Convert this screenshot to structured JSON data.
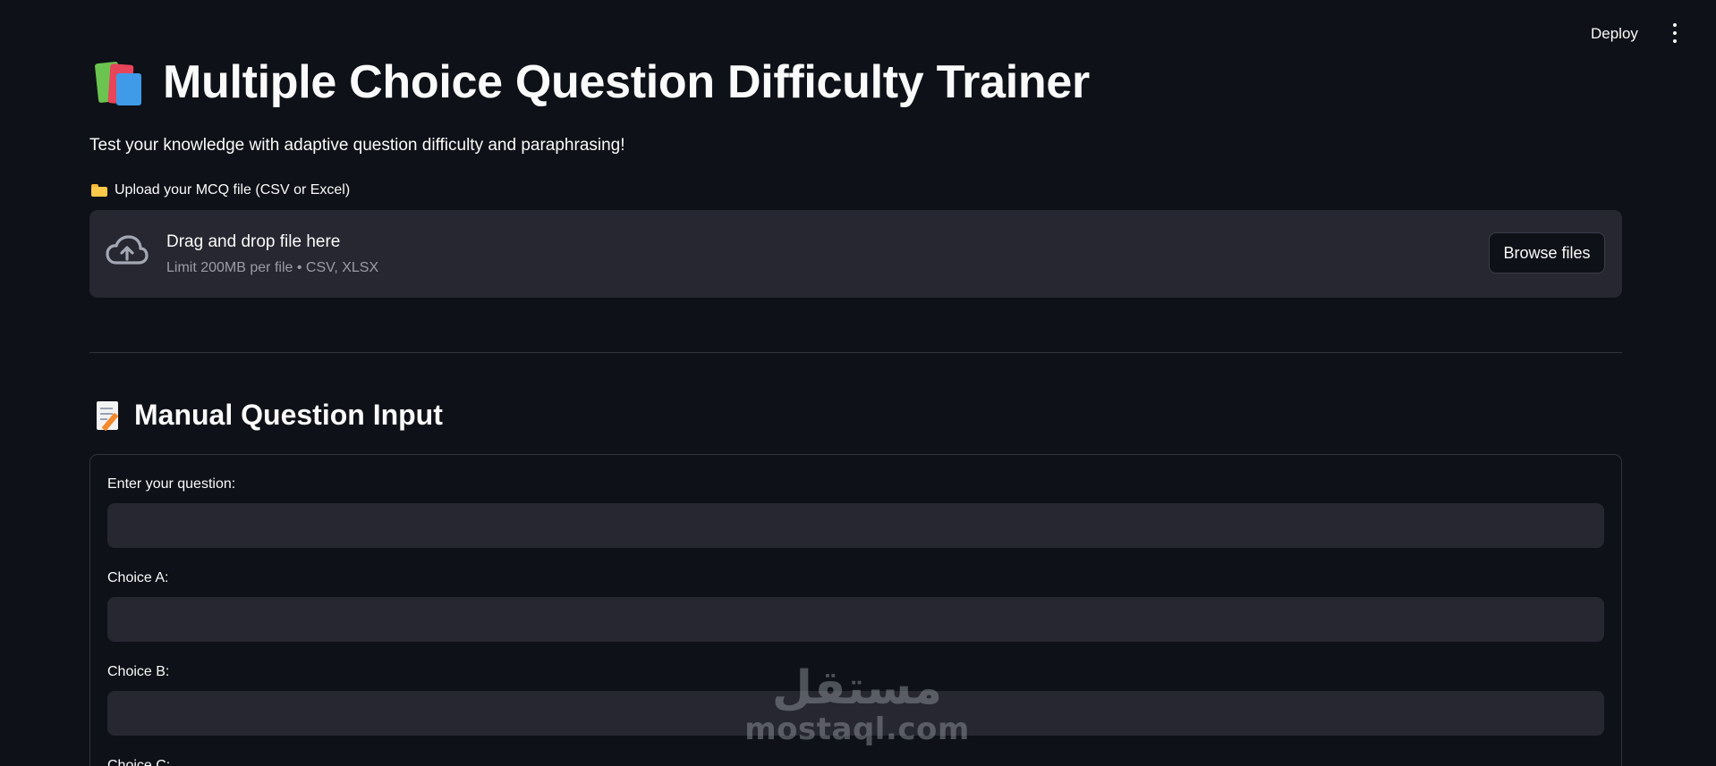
{
  "toolbar": {
    "deploy_label": "Deploy",
    "menu_icon": "more-vertical-icon"
  },
  "header": {
    "title_icon": "books-icon",
    "title": "Multiple Choice Question Difficulty Trainer",
    "subtitle": "Test your knowledge with adaptive question difficulty and paraphrasing!"
  },
  "upload": {
    "label_icon": "folder-icon",
    "label": "Upload your MCQ file (CSV or Excel)",
    "dropzone_icon": "cloud-upload-icon",
    "dropzone_title": "Drag and drop file here",
    "dropzone_subtitle": "Limit 200MB per file • CSV, XLSX",
    "browse_label": "Browse files"
  },
  "manual": {
    "section_icon": "memo-icon",
    "section_title": "Manual Question Input",
    "fields": [
      {
        "label": "Enter your question:",
        "value": ""
      },
      {
        "label": "Choice A:",
        "value": ""
      },
      {
        "label": "Choice B:",
        "value": ""
      },
      {
        "label": "Choice C:",
        "value": ""
      }
    ]
  },
  "watermark": {
    "arabic": "مستقل",
    "latin": "mostaql.com"
  },
  "colors": {
    "background": "#0e1117",
    "surface": "#262730",
    "text": "#fafafa",
    "muted": "#9b9ca5",
    "border": "#31333f"
  }
}
